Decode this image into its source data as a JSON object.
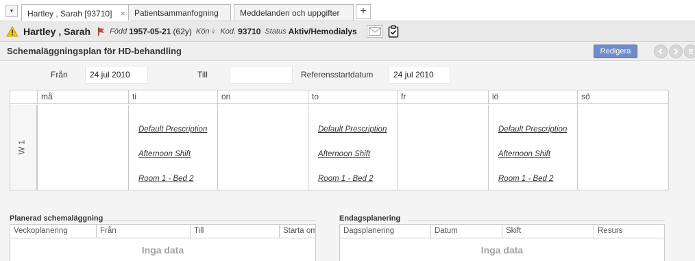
{
  "tabs": {
    "items": [
      {
        "label": "Hartley , Sarah [93710]"
      },
      {
        "label": "Patientsammanfogning"
      },
      {
        "label": "Meddelanden och uppgifter"
      }
    ],
    "add_label": "+",
    "close_glyph": "×",
    "dropdown_glyph": "▼"
  },
  "patient": {
    "name": "Hartley , Sarah",
    "born_label": "Född",
    "born_value": "1957-05-21",
    "age": "(62y)",
    "sex_label": "Kön",
    "sex_glyph": "♀",
    "code_label": "Kod.",
    "code_value": "93710",
    "status_label": "Status",
    "status_value": "Aktiv/Hemodialys",
    "icons": [
      "warning-icon",
      "gender-flag-icon",
      "mail-icon",
      "clipboard-check-icon"
    ]
  },
  "section": {
    "title": "Schemaläggningsplan för HD-behandling",
    "edit_label": "Redigera"
  },
  "filters": {
    "from_label": "Från",
    "from_value": "24 jul 2010",
    "to_label": "Till",
    "to_value": "",
    "ref_label": "Referensstartdatum",
    "ref_value": "24 jul 2010"
  },
  "schedule": {
    "days": [
      "må",
      "ti",
      "on",
      "to",
      "fr",
      "lö",
      "sö"
    ],
    "week_label": "W 1",
    "cells": [
      {
        "day": "må",
        "lines": []
      },
      {
        "day": "ti",
        "lines": [
          "Default Prescription",
          "Afternoon Shift",
          "Room 1 - Bed 2"
        ]
      },
      {
        "day": "on",
        "lines": []
      },
      {
        "day": "to",
        "lines": [
          "Default Prescription",
          "Afternoon Shift",
          "Room 1 - Bed 2"
        ]
      },
      {
        "day": "fr",
        "lines": []
      },
      {
        "day": "lö",
        "lines": [
          "Default Prescription",
          "Afternoon Shift",
          "Room 1 - Bed 2"
        ]
      },
      {
        "day": "sö",
        "lines": []
      }
    ]
  },
  "planned": {
    "title": "Planerad schemaläggning",
    "columns": [
      "Veckoplanering",
      "Från",
      "Till",
      "Starta om"
    ],
    "empty": "Inga data"
  },
  "single_day": {
    "title": "Endagsplanering",
    "columns": [
      "Dagsplanering",
      "Datum",
      "Skift",
      "Resurs"
    ],
    "empty": "Inga data"
  },
  "colors": {
    "accent": "#6f8cc8",
    "warning": "#f5c400",
    "header_bg": "#e9e9e9"
  }
}
